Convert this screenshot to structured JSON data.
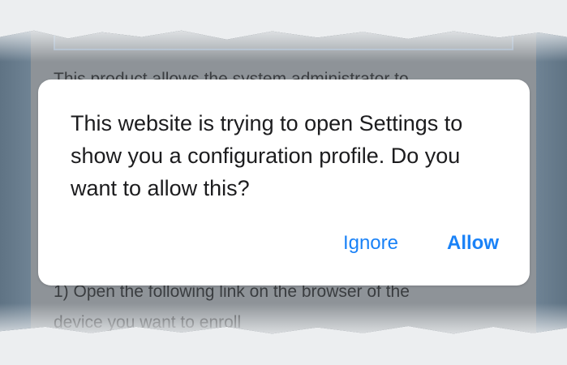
{
  "background": {
    "paragraph_fragment": "This product allows the system administrator to",
    "step_line_1": "1) Open the following link on the browser of the",
    "step_line_2": "device you want to enroll"
  },
  "dialog": {
    "message": "This website is trying to open Settings to show you a configuration profile. Do you want to allow this?",
    "ignore_label": "Ignore",
    "allow_label": "Allow"
  },
  "colors": {
    "action_blue": "#1a82f7",
    "dialog_bg": "#ffffff"
  }
}
